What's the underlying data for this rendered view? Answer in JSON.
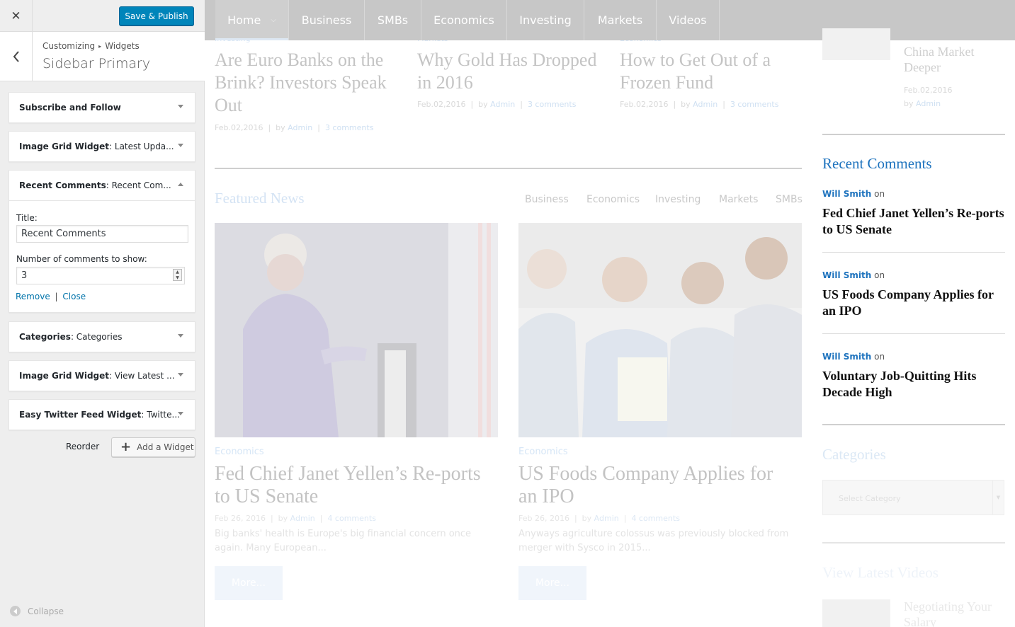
{
  "customizer": {
    "close_label": "✕",
    "save_publish": "Save & Publish",
    "breadcrumb_root": "Customizing",
    "breadcrumb_child": "Widgets",
    "section_title": "Sidebar Primary",
    "widgets": [
      {
        "type": "Subscribe and Follow",
        "title": ""
      },
      {
        "type": "Image Grid Widget",
        "title": ": Latest Upda..."
      },
      {
        "type": "Recent Comments",
        "title": ": Recent Com..."
      },
      {
        "type": "Categories",
        "title": ": Categories"
      },
      {
        "type": "Image Grid Widget",
        "title": ": View Latest ..."
      },
      {
        "type": "Easy Twitter Feed Widget",
        "title": ": Twitte..."
      }
    ],
    "form": {
      "title_label": "Title:",
      "title_value": "Recent Comments",
      "count_label": "Number of comments to show:",
      "count_value": "3",
      "remove": "Remove",
      "separator": "|",
      "close": "Close"
    },
    "reorder": "Reorder",
    "add_widget": "Add a Widget",
    "collapse": "Collapse"
  },
  "preview": {
    "nav": [
      "Home",
      "Business",
      "SMBs",
      "Economics",
      "Investing",
      "Markets",
      "Videos"
    ],
    "top_articles": [
      {
        "category": "Investing",
        "title": "Are Euro Banks on the Brink? Investors Speak Out",
        "date": "Feb.02,2016",
        "by": "by",
        "author": "Admin",
        "comments": "3 comments"
      },
      {
        "category": "Markets",
        "title": "Why Gold Has Dropped in 2016",
        "date": "Feb.02,2016",
        "by": "by",
        "author": "Admin",
        "comments": "3 comments"
      },
      {
        "category": "Economics",
        "title": "How to Get Out of a Frozen Fund",
        "date": "Feb.02,2016",
        "by": "by",
        "author": "Admin",
        "comments": "3 comments"
      }
    ],
    "featured": {
      "heading": "Featured News",
      "tabs": [
        "Business",
        "Economics",
        "Investing",
        "Markets",
        "SMBs"
      ],
      "posts": [
        {
          "category": "Economics",
          "title": "Fed Chief Janet Yellen’s Re-ports to US Senate",
          "date": "Feb 26, 2016",
          "by": "by",
          "author": "Admin",
          "comments": "4 comments",
          "excerpt": "Big banks' health is Europe's big financial concern once again. Many European...",
          "more": "More..."
        },
        {
          "category": "Economics",
          "title": "US Foods Company Applies for an IPO",
          "date": "Feb 26, 2016",
          "by": "by",
          "author": "Admin",
          "comments": "4 comments",
          "excerpt": "Anyways agriculture colossus was previously blocked from merger with Sysco in 2015...",
          "more": "More..."
        }
      ]
    },
    "sidebar_top": {
      "title": "China Market Deeper",
      "date": "Feb.02,2016",
      "by": "by",
      "author": "Admin"
    },
    "recent_comments": {
      "heading": "Recent Comments",
      "items": [
        {
          "author": "Will Smith",
          "on": "on",
          "title": "Fed Chief Janet Yellen’s Re-ports to US Senate"
        },
        {
          "author": "Will Smith",
          "on": "on",
          "title": "US Foods Company Applies for an IPO"
        },
        {
          "author": "Will Smith",
          "on": "on",
          "title": "Voluntary Job-Quitting Hits Decade High"
        }
      ]
    },
    "categories": {
      "heading": "Categories",
      "select_placeholder": "Select Category"
    },
    "videos": {
      "heading": "View Latest Videos",
      "first_title": "Negotiating Your Salary"
    }
  }
}
